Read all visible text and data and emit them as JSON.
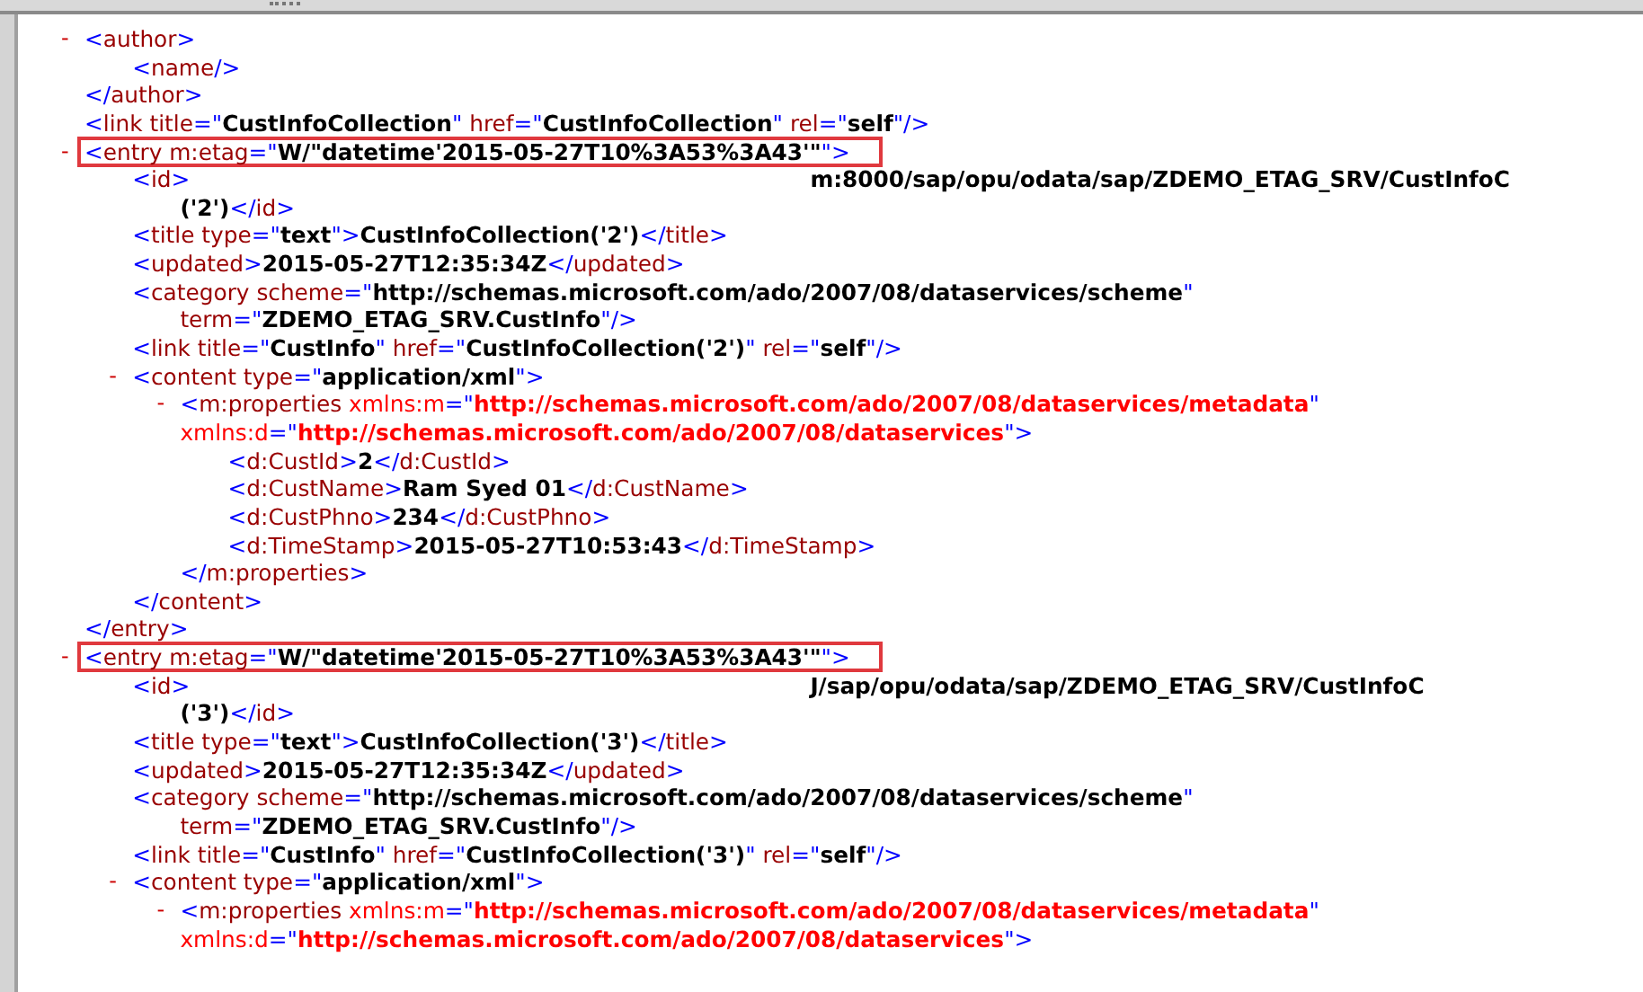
{
  "nodes": [
    {
      "toggle": "-",
      "tokens": [
        {
          "kind": "punct",
          "text": "<"
        },
        {
          "kind": "name",
          "text": "author"
        },
        {
          "kind": "punct",
          "text": ">"
        }
      ],
      "children": [
        {
          "tokens": [
            {
              "kind": "punct",
              "text": "<"
            },
            {
              "kind": "name",
              "text": "name"
            },
            {
              "kind": "punct",
              "text": "/>"
            }
          ]
        }
      ],
      "close": [
        {
          "kind": "punct",
          "text": "</"
        },
        {
          "kind": "name",
          "text": "author"
        },
        {
          "kind": "punct",
          "text": ">"
        }
      ]
    },
    {
      "tokens": [
        {
          "kind": "punct",
          "text": "<"
        },
        {
          "kind": "name",
          "text": "link"
        },
        {
          "kind": "attr",
          "text": " title"
        },
        {
          "kind": "punct",
          "text": "=\""
        },
        {
          "kind": "value",
          "text": "CustInfoCollection"
        },
        {
          "kind": "punct",
          "text": "\""
        },
        {
          "kind": "attr",
          "text": " href"
        },
        {
          "kind": "punct",
          "text": "=\""
        },
        {
          "kind": "value",
          "text": "CustInfoCollection"
        },
        {
          "kind": "punct",
          "text": "\""
        },
        {
          "kind": "attr",
          "text": " rel"
        },
        {
          "kind": "punct",
          "text": "=\""
        },
        {
          "kind": "value",
          "text": "self"
        },
        {
          "kind": "punct",
          "text": "\"/>"
        }
      ]
    },
    {
      "toggle": "-",
      "highlighted": true,
      "tokens": [
        {
          "kind": "punct",
          "text": "<"
        },
        {
          "kind": "name",
          "text": "entry"
        },
        {
          "kind": "attr",
          "text": " m:etag"
        },
        {
          "kind": "punct",
          "text": "=\""
        },
        {
          "kind": "value",
          "text": "W/\"datetime'2015-05-27T10%3A53%3A43'\""
        },
        {
          "kind": "punct",
          "text": "\">"
        }
      ],
      "children": [
        {
          "tokens": [
            {
              "kind": "punct",
              "text": "<"
            },
            {
              "kind": "name",
              "text": "id"
            },
            {
              "kind": "punct",
              "text": ">"
            },
            {
              "kind": "text_after_redaction",
              "text": "m:8000/sap/opu/odata/sap/ZDEMO_ETAG_SRV/CustInfoC"
            }
          ],
          "continuation": [
            [
              {
                "kind": "text",
                "text": "('2')"
              },
              {
                "kind": "punct",
                "text": "</"
              },
              {
                "kind": "name",
                "text": "id"
              },
              {
                "kind": "punct",
                "text": ">"
              }
            ]
          ]
        },
        {
          "tokens": [
            {
              "kind": "punct",
              "text": "<"
            },
            {
              "kind": "name",
              "text": "title"
            },
            {
              "kind": "attr",
              "text": " type"
            },
            {
              "kind": "punct",
              "text": "=\""
            },
            {
              "kind": "value",
              "text": "text"
            },
            {
              "kind": "punct",
              "text": "\">"
            },
            {
              "kind": "text",
              "text": "CustInfoCollection('2')"
            },
            {
              "kind": "punct",
              "text": "</"
            },
            {
              "kind": "name",
              "text": "title"
            },
            {
              "kind": "punct",
              "text": ">"
            }
          ]
        },
        {
          "tokens": [
            {
              "kind": "punct",
              "text": "<"
            },
            {
              "kind": "name",
              "text": "updated"
            },
            {
              "kind": "punct",
              "text": ">"
            },
            {
              "kind": "text",
              "text": "2015-05-27T12:35:34Z"
            },
            {
              "kind": "punct",
              "text": "</"
            },
            {
              "kind": "name",
              "text": "updated"
            },
            {
              "kind": "punct",
              "text": ">"
            }
          ]
        },
        {
          "tokens": [
            {
              "kind": "punct",
              "text": "<"
            },
            {
              "kind": "name",
              "text": "category"
            },
            {
              "kind": "attr",
              "text": " scheme"
            },
            {
              "kind": "punct",
              "text": "=\""
            },
            {
              "kind": "value",
              "text": "http://schemas.microsoft.com/ado/2007/08/dataservices/scheme"
            },
            {
              "kind": "punct",
              "text": "\""
            }
          ],
          "continuation": [
            [
              {
                "kind": "attr",
                "text": "term"
              },
              {
                "kind": "punct",
                "text": "=\""
              },
              {
                "kind": "value",
                "text": "ZDEMO_ETAG_SRV.CustInfo"
              },
              {
                "kind": "punct",
                "text": "\"/>"
              }
            ]
          ]
        },
        {
          "tokens": [
            {
              "kind": "punct",
              "text": "<"
            },
            {
              "kind": "name",
              "text": "link"
            },
            {
              "kind": "attr",
              "text": " title"
            },
            {
              "kind": "punct",
              "text": "=\""
            },
            {
              "kind": "value",
              "text": "CustInfo"
            },
            {
              "kind": "punct",
              "text": "\""
            },
            {
              "kind": "attr",
              "text": " href"
            },
            {
              "kind": "punct",
              "text": "=\""
            },
            {
              "kind": "value",
              "text": "CustInfoCollection('2')"
            },
            {
              "kind": "punct",
              "text": "\""
            },
            {
              "kind": "attr",
              "text": " rel"
            },
            {
              "kind": "punct",
              "text": "=\""
            },
            {
              "kind": "value",
              "text": "self"
            },
            {
              "kind": "punct",
              "text": "\"/>"
            }
          ]
        },
        {
          "toggle": "-",
          "tokens": [
            {
              "kind": "punct",
              "text": "<"
            },
            {
              "kind": "name",
              "text": "content"
            },
            {
              "kind": "attr",
              "text": " type"
            },
            {
              "kind": "punct",
              "text": "=\""
            },
            {
              "kind": "value",
              "text": "application/xml"
            },
            {
              "kind": "punct",
              "text": "\">"
            }
          ],
          "children": [
            {
              "toggle": "-",
              "tokens": [
                {
                  "kind": "punct",
                  "text": "<"
                },
                {
                  "kind": "name",
                  "text": "m:properties"
                },
                {
                  "kind": "nsattr",
                  "text": " xmlns:m"
                },
                {
                  "kind": "punct",
                  "text": "=\""
                },
                {
                  "kind": "nsvalue",
                  "text": "http://schemas.microsoft.com/ado/2007/08/dataservices/metadata"
                },
                {
                  "kind": "punct",
                  "text": "\""
                }
              ],
              "continuation": [
                [
                  {
                    "kind": "nsattr",
                    "text": "xmlns:d"
                  },
                  {
                    "kind": "punct",
                    "text": "=\""
                  },
                  {
                    "kind": "nsvalue",
                    "text": "http://schemas.microsoft.com/ado/2007/08/dataservices"
                  },
                  {
                    "kind": "punct",
                    "text": "\">"
                  }
                ]
              ],
              "children": [
                {
                  "tokens": [
                    {
                      "kind": "punct",
                      "text": "<"
                    },
                    {
                      "kind": "name",
                      "text": "d:CustId"
                    },
                    {
                      "kind": "punct",
                      "text": ">"
                    },
                    {
                      "kind": "text",
                      "text": "2"
                    },
                    {
                      "kind": "punct",
                      "text": "</"
                    },
                    {
                      "kind": "name",
                      "text": "d:CustId"
                    },
                    {
                      "kind": "punct",
                      "text": ">"
                    }
                  ]
                },
                {
                  "tokens": [
                    {
                      "kind": "punct",
                      "text": "<"
                    },
                    {
                      "kind": "name",
                      "text": "d:CustName"
                    },
                    {
                      "kind": "punct",
                      "text": ">"
                    },
                    {
                      "kind": "text",
                      "text": "Ram Syed 01"
                    },
                    {
                      "kind": "punct",
                      "text": "</"
                    },
                    {
                      "kind": "name",
                      "text": "d:CustName"
                    },
                    {
                      "kind": "punct",
                      "text": ">"
                    }
                  ]
                },
                {
                  "tokens": [
                    {
                      "kind": "punct",
                      "text": "<"
                    },
                    {
                      "kind": "name",
                      "text": "d:CustPhno"
                    },
                    {
                      "kind": "punct",
                      "text": ">"
                    },
                    {
                      "kind": "text",
                      "text": "234"
                    },
                    {
                      "kind": "punct",
                      "text": "</"
                    },
                    {
                      "kind": "name",
                      "text": "d:CustPhno"
                    },
                    {
                      "kind": "punct",
                      "text": ">"
                    }
                  ]
                },
                {
                  "tokens": [
                    {
                      "kind": "punct",
                      "text": "<"
                    },
                    {
                      "kind": "name",
                      "text": "d:TimeStamp"
                    },
                    {
                      "kind": "punct",
                      "text": ">"
                    },
                    {
                      "kind": "text",
                      "text": "2015-05-27T10:53:43"
                    },
                    {
                      "kind": "punct",
                      "text": "</"
                    },
                    {
                      "kind": "name",
                      "text": "d:TimeStamp"
                    },
                    {
                      "kind": "punct",
                      "text": ">"
                    }
                  ]
                }
              ],
              "close": [
                {
                  "kind": "punct",
                  "text": "</"
                },
                {
                  "kind": "name",
                  "text": "m:properties"
                },
                {
                  "kind": "punct",
                  "text": ">"
                }
              ]
            }
          ],
          "close": [
            {
              "kind": "punct",
              "text": "</"
            },
            {
              "kind": "name",
              "text": "content"
            },
            {
              "kind": "punct",
              "text": ">"
            }
          ]
        }
      ],
      "close": [
        {
          "kind": "punct",
          "text": "</"
        },
        {
          "kind": "name",
          "text": "entry"
        },
        {
          "kind": "punct",
          "text": ">"
        }
      ]
    },
    {
      "toggle": "-",
      "highlighted": true,
      "tokens": [
        {
          "kind": "punct",
          "text": "<"
        },
        {
          "kind": "name",
          "text": "entry"
        },
        {
          "kind": "attr",
          "text": " m:etag"
        },
        {
          "kind": "punct",
          "text": "=\""
        },
        {
          "kind": "value",
          "text": "W/\"datetime'2015-05-27T10%3A53%3A43'\""
        },
        {
          "kind": "punct",
          "text": "\">"
        }
      ],
      "children": [
        {
          "tokens": [
            {
              "kind": "punct",
              "text": "<"
            },
            {
              "kind": "name",
              "text": "id"
            },
            {
              "kind": "punct",
              "text": ">"
            },
            {
              "kind": "text_after_redaction",
              "text": "J/sap/opu/odata/sap/ZDEMO_ETAG_SRV/CustInfoC"
            }
          ],
          "continuation": [
            [
              {
                "kind": "text",
                "text": "('3')"
              },
              {
                "kind": "punct",
                "text": "</"
              },
              {
                "kind": "name",
                "text": "id"
              },
              {
                "kind": "punct",
                "text": ">"
              }
            ]
          ]
        },
        {
          "tokens": [
            {
              "kind": "punct",
              "text": "<"
            },
            {
              "kind": "name",
              "text": "title"
            },
            {
              "kind": "attr",
              "text": " type"
            },
            {
              "kind": "punct",
              "text": "=\""
            },
            {
              "kind": "value",
              "text": "text"
            },
            {
              "kind": "punct",
              "text": "\">"
            },
            {
              "kind": "text",
              "text": "CustInfoCollection('3')"
            },
            {
              "kind": "punct",
              "text": "</"
            },
            {
              "kind": "name",
              "text": "title"
            },
            {
              "kind": "punct",
              "text": ">"
            }
          ]
        },
        {
          "tokens": [
            {
              "kind": "punct",
              "text": "<"
            },
            {
              "kind": "name",
              "text": "updated"
            },
            {
              "kind": "punct",
              "text": ">"
            },
            {
              "kind": "text",
              "text": "2015-05-27T12:35:34Z"
            },
            {
              "kind": "punct",
              "text": "</"
            },
            {
              "kind": "name",
              "text": "updated"
            },
            {
              "kind": "punct",
              "text": ">"
            }
          ]
        },
        {
          "tokens": [
            {
              "kind": "punct",
              "text": "<"
            },
            {
              "kind": "name",
              "text": "category"
            },
            {
              "kind": "attr",
              "text": " scheme"
            },
            {
              "kind": "punct",
              "text": "=\""
            },
            {
              "kind": "value",
              "text": "http://schemas.microsoft.com/ado/2007/08/dataservices/scheme"
            },
            {
              "kind": "punct",
              "text": "\""
            }
          ],
          "continuation": [
            [
              {
                "kind": "attr",
                "text": "term"
              },
              {
                "kind": "punct",
                "text": "=\""
              },
              {
                "kind": "value",
                "text": "ZDEMO_ETAG_SRV.CustInfo"
              },
              {
                "kind": "punct",
                "text": "\"/>"
              }
            ]
          ]
        },
        {
          "tokens": [
            {
              "kind": "punct",
              "text": "<"
            },
            {
              "kind": "name",
              "text": "link"
            },
            {
              "kind": "attr",
              "text": " title"
            },
            {
              "kind": "punct",
              "text": "=\""
            },
            {
              "kind": "value",
              "text": "CustInfo"
            },
            {
              "kind": "punct",
              "text": "\""
            },
            {
              "kind": "attr",
              "text": " href"
            },
            {
              "kind": "punct",
              "text": "=\""
            },
            {
              "kind": "value",
              "text": "CustInfoCollection('3')"
            },
            {
              "kind": "punct",
              "text": "\""
            },
            {
              "kind": "attr",
              "text": " rel"
            },
            {
              "kind": "punct",
              "text": "=\""
            },
            {
              "kind": "value",
              "text": "self"
            },
            {
              "kind": "punct",
              "text": "\"/>"
            }
          ]
        },
        {
          "toggle": "-",
          "tokens": [
            {
              "kind": "punct",
              "text": "<"
            },
            {
              "kind": "name",
              "text": "content"
            },
            {
              "kind": "attr",
              "text": " type"
            },
            {
              "kind": "punct",
              "text": "=\""
            },
            {
              "kind": "value",
              "text": "application/xml"
            },
            {
              "kind": "punct",
              "text": "\">"
            }
          ],
          "children": [
            {
              "toggle": "-",
              "tokens": [
                {
                  "kind": "punct",
                  "text": "<"
                },
                {
                  "kind": "name",
                  "text": "m:properties"
                },
                {
                  "kind": "nsattr",
                  "text": " xmlns:m"
                },
                {
                  "kind": "punct",
                  "text": "=\""
                },
                {
                  "kind": "nsvalue",
                  "text": "http://schemas.microsoft.com/ado/2007/08/dataservices/metadata"
                },
                {
                  "kind": "punct",
                  "text": "\""
                }
              ],
              "continuation": [
                [
                  {
                    "kind": "nsattr",
                    "text": "xmlns:d"
                  },
                  {
                    "kind": "punct",
                    "text": "=\""
                  },
                  {
                    "kind": "nsvalue",
                    "text": "http://schemas.microsoft.com/ado/2007/08/dataservices"
                  },
                  {
                    "kind": "punct",
                    "text": "\">"
                  }
                ]
              ]
            }
          ]
        }
      ]
    }
  ]
}
